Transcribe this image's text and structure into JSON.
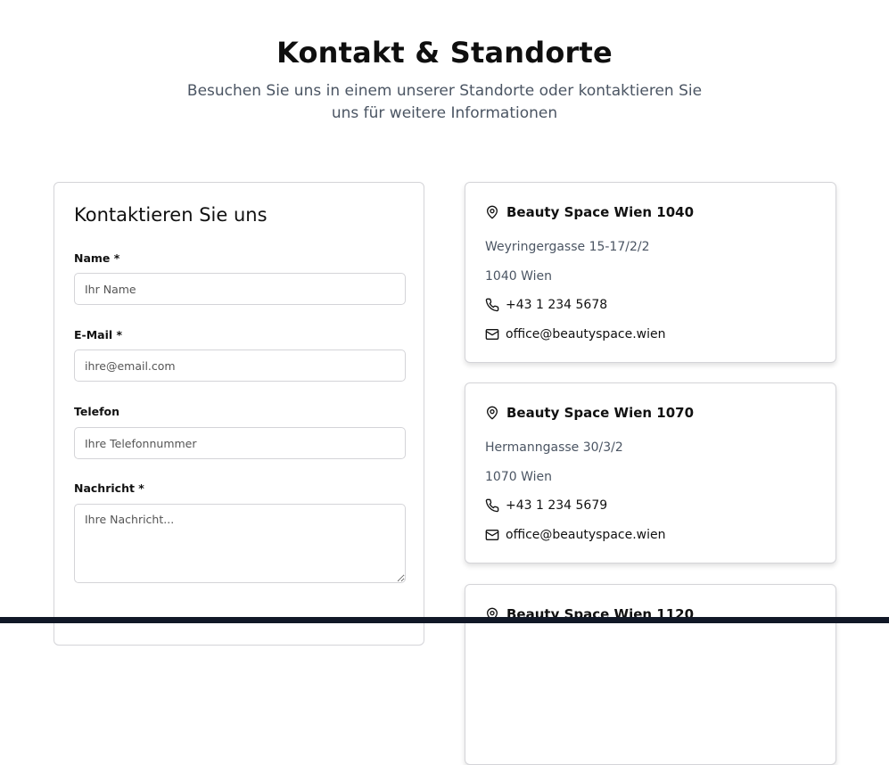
{
  "header": {
    "title": "Kontakt & Standorte",
    "subtitle": "Besuchen Sie uns in einem unserer Standorte oder kontaktieren Sie uns für weitere Informationen"
  },
  "form": {
    "title": "Kontaktieren Sie uns",
    "fields": [
      {
        "label": "Name *",
        "placeholder": "Ihr Name"
      },
      {
        "label": "E-Mail *",
        "placeholder": "ihre@email.com"
      },
      {
        "label": "Telefon",
        "placeholder": "Ihre Telefonnummer"
      },
      {
        "label": "Nachricht *",
        "placeholder": "Ihre Nachricht..."
      }
    ]
  },
  "locations": [
    {
      "name": "Beauty Space Wien 1040",
      "street": "Weyringergasse 15-17/2/2",
      "city": "1040 Wien",
      "phone": "+43 1 234 5678",
      "email": "office@beautyspace.wien"
    },
    {
      "name": "Beauty Space Wien 1070",
      "street": "Hermanngasse 30/3/2",
      "city": "1070 Wien",
      "phone": "+43 1 234 5679",
      "email": "office@beautyspace.wien"
    },
    {
      "name": "Beauty Space Wien 1120"
    }
  ],
  "icons": {
    "location": "map-pin-icon",
    "phone": "phone-icon",
    "email": "mail-icon"
  }
}
